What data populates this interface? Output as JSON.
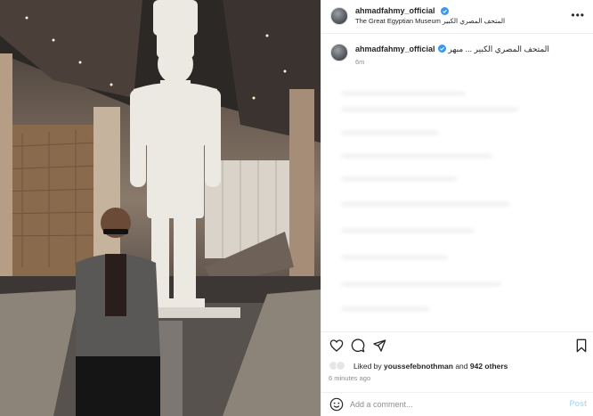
{
  "post": {
    "username": "ahmadfahmy_official",
    "location": "The Great Egyptian Museum المتحف المصري الكبير",
    "caption_username": "ahmadfahmy_official",
    "caption_text": "المتحف المصري الكبير ... مبهر",
    "caption_time": "6m",
    "likes_prefix": "Liked by ",
    "likes_user": "youssefebnothman",
    "likes_middle": " and ",
    "likes_count": "942 others",
    "posted_ago": "6 minutes ago",
    "comment_placeholder": "Add a comment...",
    "post_label": "Post",
    "more_label": "•••"
  },
  "icons": {
    "verified": "verified-badge-icon",
    "like": "heart-icon",
    "comment": "comment-bubble-icon",
    "share": "paper-plane-icon",
    "save": "bookmark-icon",
    "emoji": "emoji-icon"
  },
  "colors": {
    "verified_blue": "#3897f0",
    "text": "#262626",
    "muted": "#8e8e8e",
    "post_disabled": "#b2dffc",
    "divider": "#efefef"
  }
}
